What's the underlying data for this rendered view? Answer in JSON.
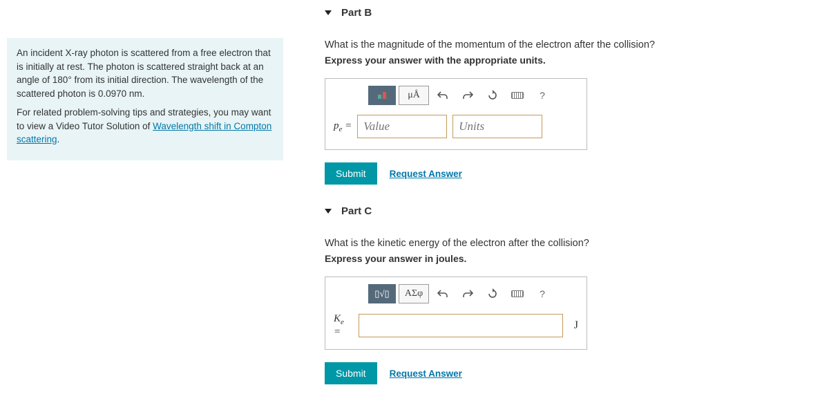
{
  "sidebar": {
    "problem_text_1": "An incident X-ray photon is scattered from a free electron that is initially at rest. The photon is scattered straight back at an angle of 180° from its initial direction. The wavelength of the scattered photon is 0.0970 nm.",
    "related_intro": "For related problem-solving tips and strategies, you may want to view a Video Tutor Solution of ",
    "related_link": "Wavelength shift in Compton scattering"
  },
  "partB": {
    "title": "Part B",
    "question": "What is the magnitude of the momentum of the electron after the collision?",
    "instruction": "Express your answer with the appropriate units.",
    "var_html": "p<sub>e</sub> =",
    "value_placeholder": "Value",
    "units_placeholder": "Units",
    "toolbar": {
      "units_btn": "μÅ",
      "help": "?"
    },
    "submit": "Submit",
    "request": "Request Answer"
  },
  "partC": {
    "title": "Part C",
    "question": "What is the kinetic energy of the electron after the collision?",
    "instruction": "Express your answer in joules.",
    "var_html": "K<sub>e</sub> =",
    "unit_suffix": "J",
    "toolbar": {
      "greek_btn": "ΑΣφ",
      "help": "?"
    },
    "submit": "Submit",
    "request": "Request Answer"
  }
}
